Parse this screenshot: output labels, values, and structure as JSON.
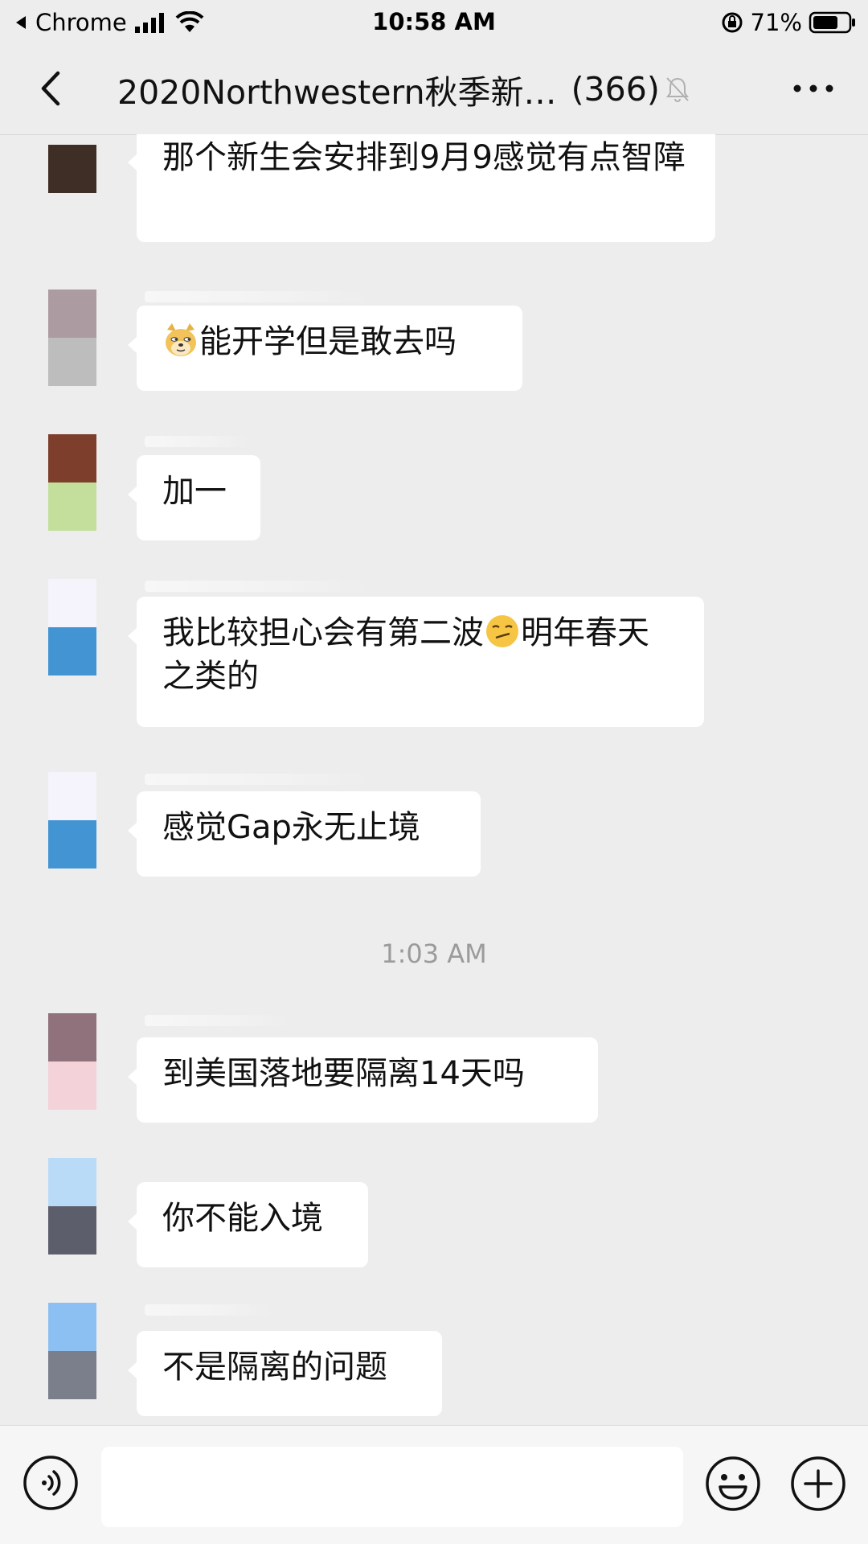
{
  "status_bar": {
    "back_app": "Chrome",
    "time": "10:58 AM",
    "battery": "71%"
  },
  "header": {
    "title": "2020Northwestern秋季新…",
    "member_count": "(366)"
  },
  "messages": [
    {
      "text": "那个新生会安排到9月9感觉有点智障",
      "avatar_colors": [
        "#3f2e26"
      ]
    },
    {
      "text": "能开学但是敢去吗",
      "emoji": "doge-face",
      "avatar_colors": [
        "#ad9ba2",
        "#bdbdbd"
      ]
    },
    {
      "text": "加一",
      "avatar_colors": [
        "#7d3f2b",
        "#c3df9b"
      ]
    },
    {
      "text": "我比较担心会有第二波",
      "text_after_emoji": "明年春天之类的",
      "emoji": "smirk-face",
      "avatar_colors": [
        "#f5f3fb",
        "#4294d2"
      ]
    },
    {
      "text": "感觉Gap永无止境",
      "avatar_colors": [
        "#f5f3fb",
        "#4294d2"
      ]
    },
    {
      "text": "到美国落地要隔离14天吗",
      "avatar_colors": [
        "#8f727b",
        "#f4d2da"
      ]
    },
    {
      "text": "你不能入境",
      "avatar_colors": [
        "#b9dbf8",
        "#5d5e6c"
      ]
    },
    {
      "text": "不是隔离的问题",
      "avatar_colors": [
        "#8dc0f2",
        "#7b7e8b"
      ]
    }
  ],
  "timestamp": "1:03 AM",
  "input": {
    "value": ""
  },
  "colors": {
    "background": "#ededed",
    "bubble": "#ffffff",
    "timestamp": "#9b9b9b"
  }
}
